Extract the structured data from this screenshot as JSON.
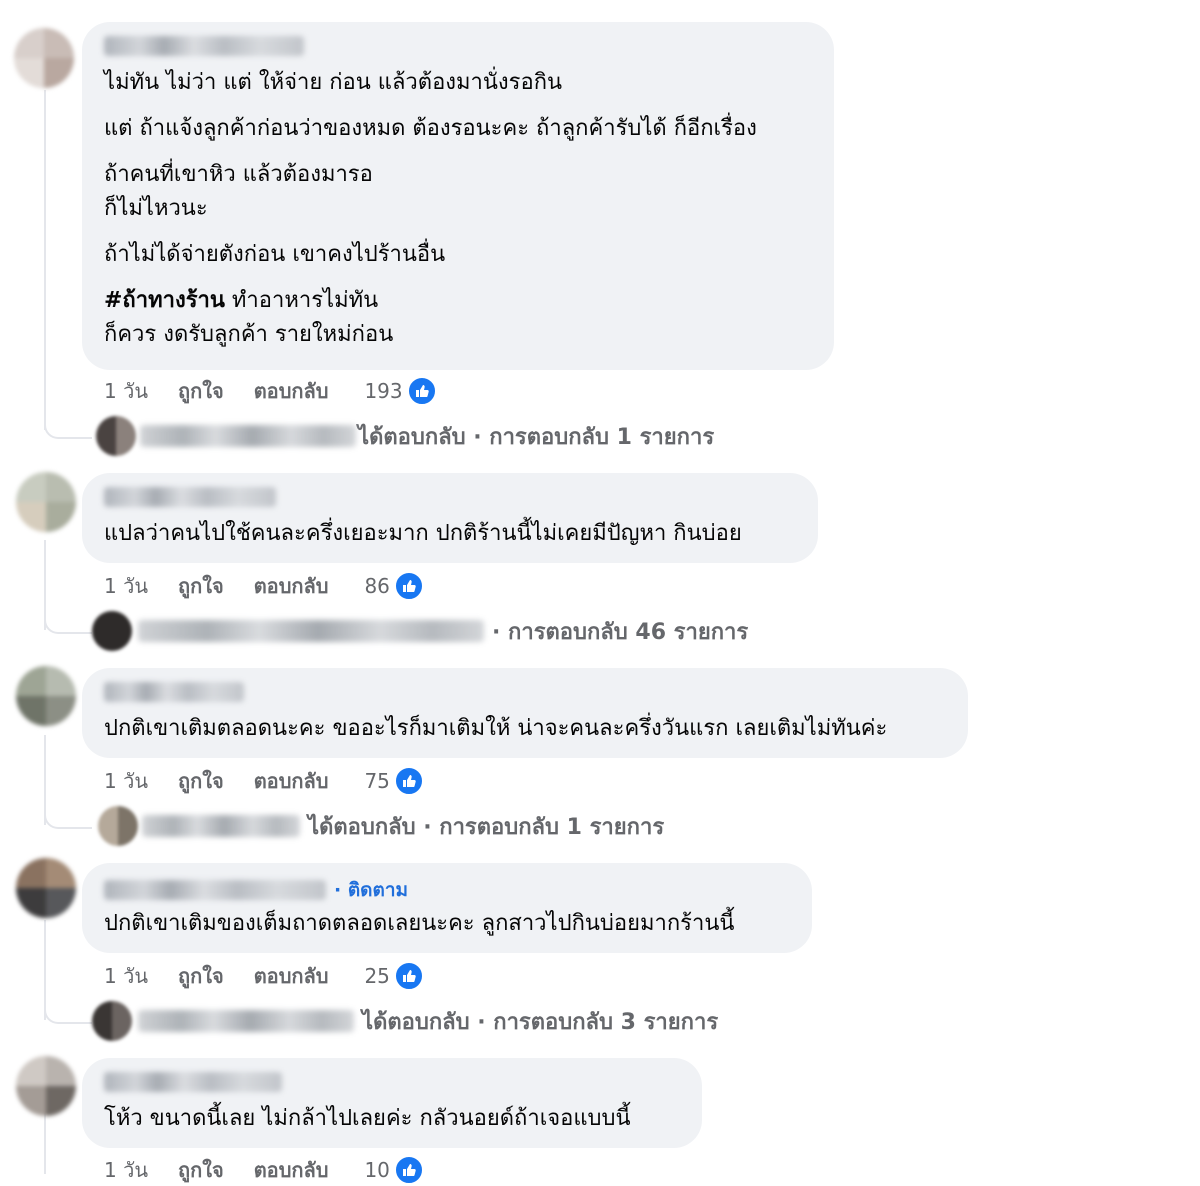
{
  "comments": [
    {
      "lines": [
        "ไม่ทัน ไม่ว่า แต่ ให้จ่าย ก่อน แล้วต้องมานั่งรอกิน",
        "แต่ ถ้าแจ้งลูกค้าก่อนว่าของหมด ต้องรอนะคะ ถ้าลูกค้ารับได้ ก็อีกเรื่อง",
        "ถ้าคนที่เขาหิว แล้วต้องมารอ",
        "ก็ไม่ไหวนะ",
        "ถ้าไม่ได้จ่ายตังก่อน เขาคงไปร้านอื่น",
        "#ถ้าทางร้าน",
        " ทำอาหารไม่ทัน",
        "ก็ควร งดรับลูกค้า รายใหม่ก่อน"
      ],
      "time": "1 วัน",
      "like_label": "ถูกใจ",
      "reply_label": "ตอบกลับ",
      "like_count": "193",
      "replies_summary": "ได้ตอบกลับ · การตอบกลับ 1 รายการ"
    },
    {
      "lines": [
        "แปลว่าคนไปใช้คนละครึ่งเยอะมาก ปกติร้านนี้ไม่เคยมีปัญหา กินบ่อย"
      ],
      "time": "1 วัน",
      "like_label": "ถูกใจ",
      "reply_label": "ตอบกลับ",
      "like_count": "86",
      "replies_summary": "· การตอบกลับ 46 รายการ"
    },
    {
      "lines": [
        "ปกติเขาเติมตลอดนะคะ ขออะไรก็มาเติมให้ น่าจะคนละครึ่งวันแรก เลยเติมไม่ทันค่ะ"
      ],
      "time": "1 วัน",
      "like_label": "ถูกใจ",
      "reply_label": "ตอบกลับ",
      "like_count": "75",
      "replies_summary": "ได้ตอบกลับ · การตอบกลับ 1 รายการ"
    },
    {
      "follow_label": "· ติดตาม",
      "lines": [
        "ปกติเขาเติมของเต็มถาดตลอดเลยนะคะ ลูกสาวไปกินบ่อยมากร้านนี้"
      ],
      "time": "1 วัน",
      "like_label": "ถูกใจ",
      "reply_label": "ตอบกลับ",
      "like_count": "25",
      "replies_summary": "ได้ตอบกลับ · การตอบกลับ 3 รายการ"
    },
    {
      "lines": [
        "โห้ว ขนาดนี้เลย ไม่กล้าไปเลยค่ะ กลัวนอยด์ถ้าเจอแบบนี้"
      ],
      "time": "1 วัน",
      "like_label": "ถูกใจ",
      "reply_label": "ตอบกลับ",
      "like_count": "10"
    }
  ],
  "icons": {
    "like": "thumbs-up-icon"
  },
  "colors": {
    "bubble": "#f0f2f5",
    "meta_text": "#65676b",
    "like_blue": "#1877f2",
    "follow_blue": "#216fdb",
    "thread_line": "#e4e6eb"
  }
}
